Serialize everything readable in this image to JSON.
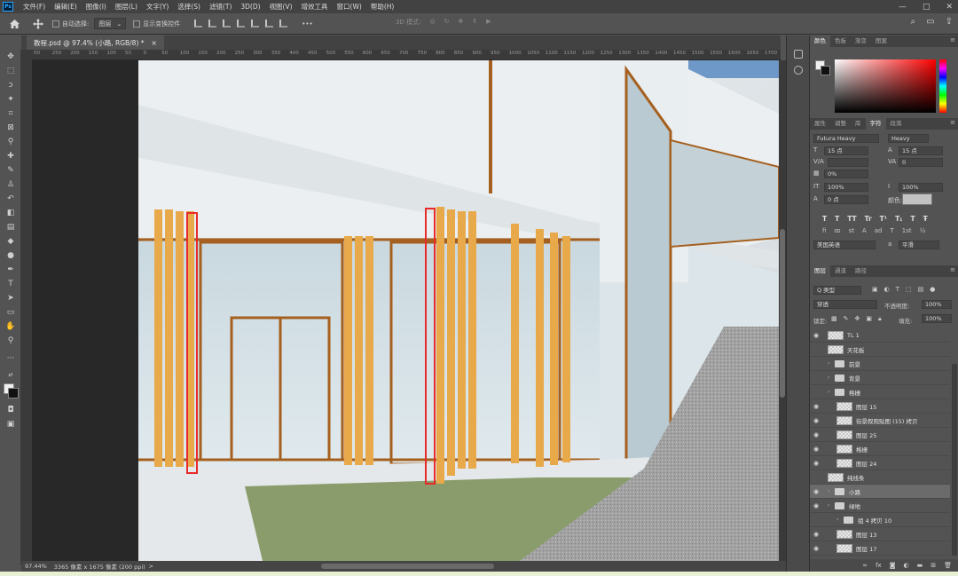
{
  "menu": {
    "logo": "Ps",
    "items": [
      "文件(F)",
      "编辑(E)",
      "图像(I)",
      "图层(L)",
      "文字(Y)",
      "选择(S)",
      "滤镜(T)",
      "3D(D)",
      "视图(V)",
      "增效工具",
      "窗口(W)",
      "帮助(H)"
    ],
    "window_controls": [
      "—",
      "□",
      "✕"
    ]
  },
  "options_bar": {
    "auto_select_label": "自动选择:",
    "auto_select_value": "图层",
    "transform_label": "显示变换控件",
    "more": "•••",
    "mode_3d_label": "3D 模式:"
  },
  "document": {
    "tab_title": "教程.psd @ 97.4% (小路, RGB/8) *",
    "close": "×"
  },
  "ruler": {
    "ticks": [
      "00",
      "250",
      "200",
      "150",
      "100",
      "50",
      "0",
      "50",
      "100",
      "150",
      "200",
      "250",
      "300",
      "350",
      "400",
      "450",
      "500",
      "550",
      "600",
      "650",
      "700",
      "750",
      "800",
      "850",
      "900",
      "950",
      "1000",
      "1050",
      "1100",
      "1150",
      "1200",
      "1250",
      "1300",
      "1350",
      "1400",
      "1450",
      "1500",
      "1550",
      "1600",
      "1650",
      "1700",
      "1750"
    ]
  },
  "status": {
    "zoom": "97.44%",
    "info": "3365 像素 x 1675 像素 (200 ppi)",
    "arrow": ">"
  },
  "color_panel": {
    "tabs": [
      "颜色",
      "色板",
      "渐变",
      "图案"
    ],
    "active_tab": 0,
    "fg_color": "#f0f0f0",
    "bg_color": "#111111"
  },
  "character_panel": {
    "tabs": [
      "属性",
      "调整",
      "库",
      "字符",
      "段落"
    ],
    "active_tab": 3,
    "font_family": "Futura Heavy",
    "font_style": "Heavy",
    "size": "15 点",
    "leading": "15 点",
    "kerning": "",
    "tracking": "0",
    "scale_pct": "0%",
    "vscale": "100%",
    "hscale": "100%",
    "baseline": "0 点",
    "color_label": "颜色:",
    "text_styles": [
      "T",
      "T",
      "TT",
      "Tr",
      "T¹",
      "T₁",
      "T",
      "Ŧ"
    ],
    "opentype": [
      "fi",
      "ꝏ",
      "st",
      "A",
      "ad",
      "T",
      "1st",
      "½"
    ],
    "language": "美国英语",
    "aa_label": "a",
    "aa_value": "平滑"
  },
  "layers_panel": {
    "tabs": [
      "图层",
      "通道",
      "路径"
    ],
    "active_tab": 0,
    "filter_label": "Q 类型",
    "blend_mode": "穿透",
    "opacity_label": "不透明度:",
    "opacity_value": "100%",
    "lock_label": "锁定:",
    "fill_label": "填充:",
    "fill_value": "100%",
    "rows": [
      {
        "name": "TL 1",
        "type": "layer",
        "eye": true,
        "indent": 0,
        "selected": false
      },
      {
        "name": "天花板",
        "type": "layer",
        "eye": false,
        "indent": 0,
        "selected": false
      },
      {
        "name": "前景",
        "type": "group",
        "eye": false,
        "indent": 0,
        "selected": false
      },
      {
        "name": "背景",
        "type": "group",
        "eye": false,
        "indent": 0,
        "selected": false
      },
      {
        "name": "格栅",
        "type": "group",
        "eye": false,
        "indent": 0,
        "selected": false
      },
      {
        "name": "图层 15",
        "type": "layer",
        "eye": true,
        "indent": 1,
        "selected": false
      },
      {
        "name": "街景叙观贴图 (15) 拷贝",
        "type": "layer",
        "eye": true,
        "indent": 1,
        "selected": false
      },
      {
        "name": "图层 25",
        "type": "layer",
        "eye": true,
        "indent": 1,
        "selected": false
      },
      {
        "name": "格栅",
        "type": "layer",
        "eye": true,
        "indent": 1,
        "selected": false
      },
      {
        "name": "图层 24",
        "type": "layer",
        "eye": true,
        "indent": 1,
        "selected": false
      },
      {
        "name": "纯线条",
        "type": "layer",
        "eye": false,
        "indent": 0,
        "selected": false
      },
      {
        "name": "小路",
        "type": "group",
        "eye": true,
        "indent": 0,
        "selected": true
      },
      {
        "name": "绿地",
        "type": "group",
        "eye": true,
        "indent": 0,
        "selected": false
      },
      {
        "name": "组 4 拷贝 10",
        "type": "group",
        "eye": false,
        "indent": 1,
        "selected": false
      },
      {
        "name": "图层 13",
        "type": "layer",
        "eye": true,
        "indent": 1,
        "selected": false
      },
      {
        "name": "图层 17",
        "type": "layer",
        "eye": true,
        "indent": 1,
        "selected": false
      }
    ],
    "footer_icons": [
      "link-icon",
      "fx-icon",
      "mask-icon",
      "adjustment-icon",
      "group-icon",
      "new-layer-icon",
      "trash-icon"
    ]
  },
  "colors": {
    "grille_orange": "#e8a94a",
    "highlight_red": "#e82a2a",
    "frame_brown": "#a5601f",
    "grass": "#8a9c6c",
    "path_gray": "#9a9a9a"
  }
}
